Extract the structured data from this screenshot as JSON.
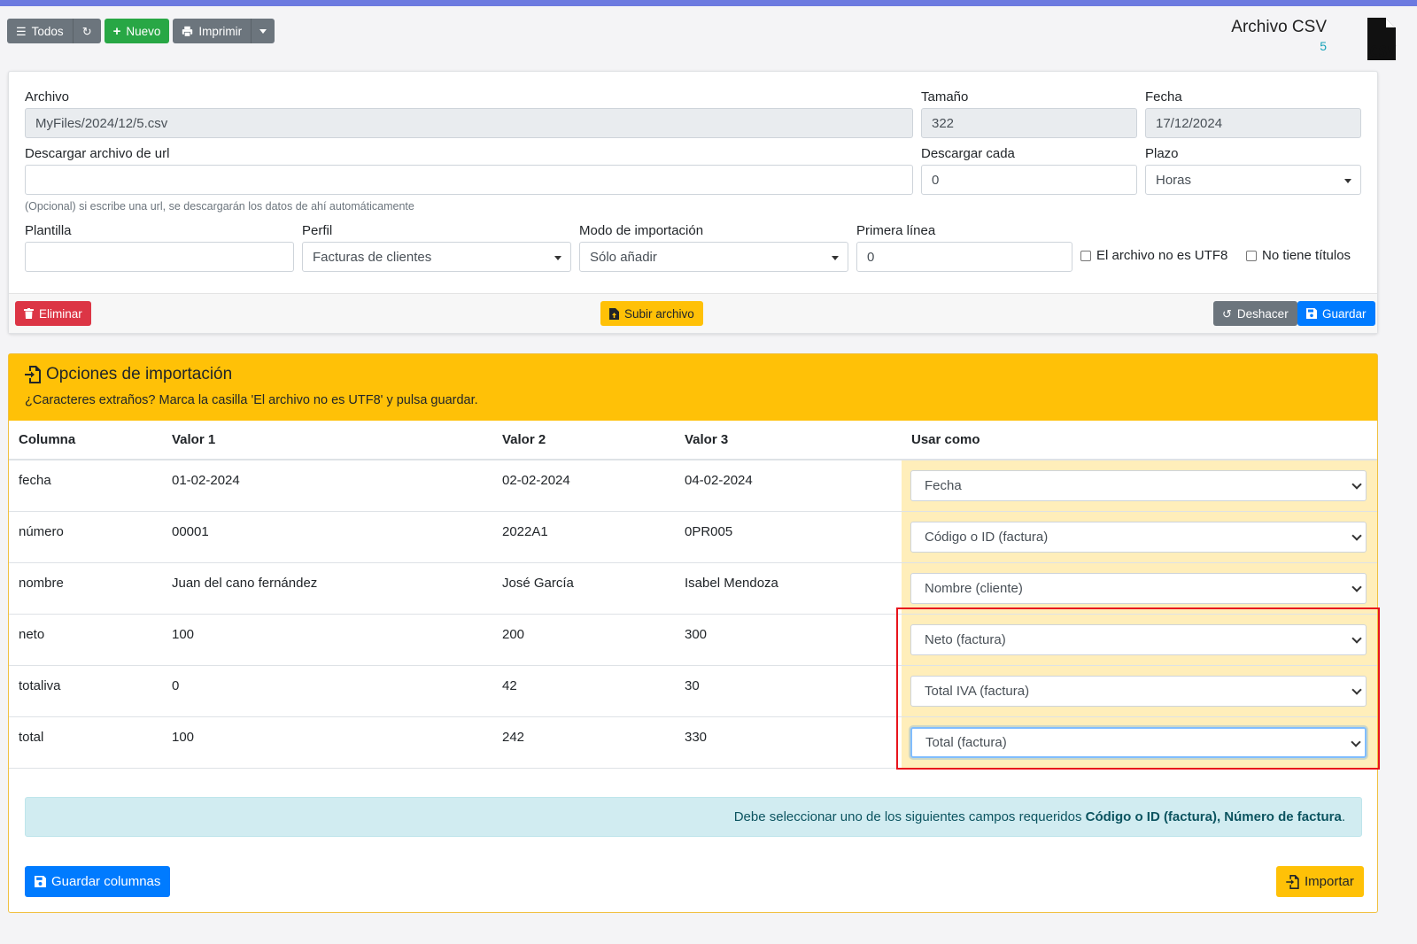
{
  "toolbar": {
    "all_label": "Todos",
    "new_label": "Nuevo",
    "print_label": "Imprimir"
  },
  "header": {
    "title": "Archivo CSV",
    "count": "5",
    "icon_text": "CSV"
  },
  "form": {
    "file_label": "Archivo",
    "file_value": "MyFiles/2024/12/5.csv",
    "size_label": "Tamaño",
    "size_value": "322",
    "date_label": "Fecha",
    "date_value": "17/12/2024",
    "url_label": "Descargar archivo de url",
    "url_value": "",
    "url_help": "(Opcional) si escribe una url, se descargarán los datos de ahí automáticamente",
    "every_label": "Descargar cada",
    "every_value": "0",
    "term_label": "Plazo",
    "term_value": "Horas",
    "template_label": "Plantilla",
    "template_value": "",
    "profile_label": "Perfil",
    "profile_value": "Facturas de clientes",
    "mode_label": "Modo de importación",
    "mode_value": "Sólo añadir",
    "first_line_label": "Primera línea",
    "first_line_value": "0",
    "utf8_label": "El archivo no es UTF8",
    "no_titles_label": "No tiene títulos"
  },
  "actions": {
    "delete_label": "Eliminar",
    "upload_label": "Subir archivo",
    "undo_label": "Deshacer",
    "save_label": "Guardar"
  },
  "import": {
    "title": "Opciones de importación",
    "subtitle": "¿Caracteres extraños? Marca la casilla 'El archivo no es UTF8' y pulsa guardar.",
    "columns": [
      "Columna",
      "Valor 1",
      "Valor 2",
      "Valor 3",
      "Usar como"
    ],
    "rows": [
      {
        "col": "fecha",
        "v1": "01-02-2024",
        "v2": "02-02-2024",
        "v3": "04-02-2024",
        "use": "Fecha"
      },
      {
        "col": "número",
        "v1": "00001",
        "v2": "2022A1",
        "v3": "0PR005",
        "use": "Código o ID (factura)"
      },
      {
        "col": "nombre",
        "v1": "Juan del cano fernández",
        "v2": "José García",
        "v3": "Isabel Mendoza",
        "use": "Nombre (cliente)"
      },
      {
        "col": "neto",
        "v1": "100",
        "v2": "200",
        "v3": "300",
        "use": "Neto (factura)"
      },
      {
        "col": "totaliva",
        "v1": "0",
        "v2": "42",
        "v3": "30",
        "use": "Total IVA (factura)"
      },
      {
        "col": "total",
        "v1": "100",
        "v2": "242",
        "v3": "330",
        "use": "Total (factura)"
      }
    ],
    "alert_prefix": "Debe seleccionar uno de los siguientes campos requeridos",
    "alert_fields": "Código o ID (factura), Número de factura",
    "alert_suffix": ".",
    "save_columns_label": "Guardar columnas",
    "import_label": "Importar"
  },
  "colors": {
    "accent_bar": "#6c7ae0",
    "warning": "#ffc107",
    "primary": "#007bff",
    "success": "#28a745",
    "danger": "#dc3545",
    "highlight_box": "#e8141c"
  }
}
